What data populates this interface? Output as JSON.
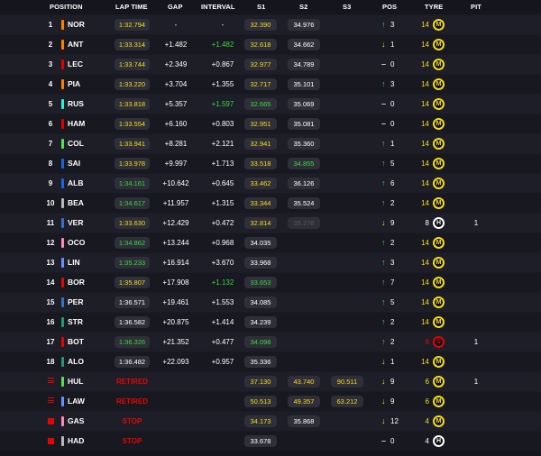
{
  "header": {
    "position": "POSITION",
    "lap_time": "LAP TIME",
    "gap": "GAP",
    "interval": "INTERVAL",
    "s1": "S1",
    "s2": "S2",
    "s3": "S3",
    "pos": "POS",
    "tyre": "TYRE",
    "pit": "PIT"
  },
  "colors": {
    "personal_best": "#3ad83a",
    "normal_time": "#f3de19",
    "retired": "#e10600",
    "medium_tyre": "#f3de19",
    "hard_tyre": "#ffffff",
    "soft_tyre": "#e10600"
  },
  "rows": [
    {
      "pos": "1",
      "status": "normal",
      "team_color": "#ff8000",
      "driver": "NOR",
      "lap": "1:32.794",
      "lap_color": "yellow",
      "gap": "-",
      "interval": "-",
      "interval_color": "white",
      "s1": "32.390",
      "s1_color": "yellow",
      "s2": "34.976",
      "s2_color": "white",
      "s3": "",
      "s3_color": "white",
      "dir": "up",
      "pos_change": "3",
      "tyre_laps": "14",
      "tyre_laps_color": "yellow",
      "tyre": "medium",
      "tyre_letter": "M",
      "pit": ""
    },
    {
      "pos": "2",
      "status": "normal",
      "team_color": "#ff8000",
      "driver": "ANT",
      "lap": "1:33.314",
      "lap_color": "yellow",
      "gap": "+1.482",
      "interval": "+1.482",
      "interval_color": "green",
      "s1": "32.618",
      "s1_color": "yellow",
      "s2": "34.662",
      "s2_color": "white",
      "s3": "",
      "s3_color": "white",
      "dir": "down",
      "pos_change": "1",
      "tyre_laps": "14",
      "tyre_laps_color": "yellow",
      "tyre": "medium",
      "tyre_letter": "M",
      "pit": ""
    },
    {
      "pos": "3",
      "status": "normal",
      "team_color": "#dc0000",
      "driver": "LEC",
      "lap": "1:33.744",
      "lap_color": "yellow",
      "gap": "+2.349",
      "interval": "+0.867",
      "interval_color": "white",
      "s1": "32.977",
      "s1_color": "yellow",
      "s2": "34.789",
      "s2_color": "white",
      "s3": "",
      "s3_color": "white",
      "dir": "same",
      "pos_change": "0",
      "tyre_laps": "14",
      "tyre_laps_color": "yellow",
      "tyre": "medium",
      "tyre_letter": "M",
      "pit": ""
    },
    {
      "pos": "4",
      "status": "normal",
      "team_color": "#ff8000",
      "driver": "PIA",
      "lap": "1:33.220",
      "lap_color": "yellow",
      "gap": "+3.704",
      "interval": "+1.355",
      "interval_color": "white",
      "s1": "32.717",
      "s1_color": "yellow",
      "s2": "35.101",
      "s2_color": "white",
      "s3": "",
      "s3_color": "white",
      "dir": "up",
      "pos_change": "3",
      "tyre_laps": "14",
      "tyre_laps_color": "yellow",
      "tyre": "medium",
      "tyre_letter": "M",
      "pit": ""
    },
    {
      "pos": "5",
      "status": "normal",
      "team_color": "#27f4d2",
      "driver": "RUS",
      "lap": "1:33.818",
      "lap_color": "yellow",
      "gap": "+5.357",
      "interval": "+1.597",
      "interval_color": "green",
      "s1": "32.665",
      "s1_color": "green",
      "s2": "35.069",
      "s2_color": "white",
      "s3": "",
      "s3_color": "white",
      "dir": "same",
      "pos_change": "0",
      "tyre_laps": "14",
      "tyre_laps_color": "yellow",
      "tyre": "medium",
      "tyre_letter": "M",
      "pit": ""
    },
    {
      "pos": "6",
      "status": "normal",
      "team_color": "#dc0000",
      "driver": "HAM",
      "lap": "1:33.554",
      "lap_color": "yellow",
      "gap": "+6.160",
      "interval": "+0.803",
      "interval_color": "white",
      "s1": "32.951",
      "s1_color": "yellow",
      "s2": "35.081",
      "s2_color": "white",
      "s3": "",
      "s3_color": "white",
      "dir": "same",
      "pos_change": "0",
      "tyre_laps": "14",
      "tyre_laps_color": "yellow",
      "tyre": "medium",
      "tyre_letter": "M",
      "pit": ""
    },
    {
      "pos": "7",
      "status": "normal",
      "team_color": "#52e252",
      "driver": "COL",
      "lap": "1:33.941",
      "lap_color": "yellow",
      "gap": "+8.281",
      "interval": "+2.121",
      "interval_color": "white",
      "s1": "32.941",
      "s1_color": "yellow",
      "s2": "35.360",
      "s2_color": "white",
      "s3": "",
      "s3_color": "white",
      "dir": "up",
      "pos_change": "1",
      "tyre_laps": "14",
      "tyre_laps_color": "yellow",
      "tyre": "medium",
      "tyre_letter": "M",
      "pit": ""
    },
    {
      "pos": "8",
      "status": "normal",
      "team_color": "#1868db",
      "driver": "SAI",
      "lap": "1:33.978",
      "lap_color": "yellow",
      "gap": "+9.997",
      "interval": "+1.713",
      "interval_color": "white",
      "s1": "33.518",
      "s1_color": "yellow",
      "s2": "34.855",
      "s2_color": "green",
      "s3": "",
      "s3_color": "white",
      "dir": "up",
      "pos_change": "5",
      "tyre_laps": "14",
      "tyre_laps_color": "yellow",
      "tyre": "medium",
      "tyre_letter": "M",
      "pit": ""
    },
    {
      "pos": "9",
      "status": "normal",
      "team_color": "#1868db",
      "driver": "ALB",
      "lap": "1:34.161",
      "lap_color": "green",
      "gap": "+10.642",
      "interval": "+0.645",
      "interval_color": "white",
      "s1": "33.462",
      "s1_color": "yellow",
      "s2": "36.126",
      "s2_color": "white",
      "s3": "",
      "s3_color": "white",
      "dir": "up",
      "pos_change": "6",
      "tyre_laps": "14",
      "tyre_laps_color": "yellow",
      "tyre": "medium",
      "tyre_letter": "M",
      "pit": ""
    },
    {
      "pos": "10",
      "status": "normal",
      "team_color": "#b6babd",
      "driver": "BEA",
      "lap": "1:34.617",
      "lap_color": "green",
      "gap": "+11.957",
      "interval": "+1.315",
      "interval_color": "white",
      "s1": "33.344",
      "s1_color": "yellow",
      "s2": "35.524",
      "s2_color": "white",
      "s3": "",
      "s3_color": "white",
      "dir": "up",
      "pos_change": "2",
      "tyre_laps": "14",
      "tyre_laps_color": "yellow",
      "tyre": "medium",
      "tyre_letter": "M",
      "pit": ""
    },
    {
      "pos": "11",
      "status": "normal",
      "team_color": "#3671c6",
      "driver": "VER",
      "lap": "1:33.630",
      "lap_color": "yellow",
      "gap": "+12.429",
      "interval": "+0.472",
      "interval_color": "white",
      "s1": "32.814",
      "s1_color": "yellow",
      "s2": "35.278",
      "s2_color": "faded",
      "s3": "",
      "s3_color": "white",
      "dir": "down",
      "pos_change": "9",
      "tyre_laps": "8",
      "tyre_laps_color": "white",
      "tyre": "hard",
      "tyre_letter": "H",
      "pit": "1"
    },
    {
      "pos": "12",
      "status": "normal",
      "team_color": "#ff87bc",
      "driver": "OCO",
      "lap": "1:34.862",
      "lap_color": "green",
      "gap": "+13.244",
      "interval": "+0.968",
      "interval_color": "white",
      "s1": "34.035",
      "s1_color": "white",
      "s2": "",
      "s2_color": "white",
      "s3": "",
      "s3_color": "white",
      "dir": "up",
      "pos_change": "2",
      "tyre_laps": "14",
      "tyre_laps_color": "yellow",
      "tyre": "medium",
      "tyre_letter": "M",
      "pit": ""
    },
    {
      "pos": "13",
      "status": "normal",
      "team_color": "#6692ff",
      "driver": "LIN",
      "lap": "1:35.233",
      "lap_color": "green",
      "gap": "+16.914",
      "interval": "+3.670",
      "interval_color": "white",
      "s1": "33.968",
      "s1_color": "white",
      "s2": "",
      "s2_color": "white",
      "s3": "",
      "s3_color": "white",
      "dir": "up",
      "pos_change": "3",
      "tyre_laps": "14",
      "tyre_laps_color": "yellow",
      "tyre": "medium",
      "tyre_letter": "M",
      "pit": ""
    },
    {
      "pos": "14",
      "status": "normal",
      "team_color": "#e10600",
      "driver": "BOR",
      "lap": "1:35.807",
      "lap_color": "yellow",
      "gap": "+17.908",
      "interval": "+1.132",
      "interval_color": "green",
      "s1": "33.653",
      "s1_color": "green",
      "s2": "",
      "s2_color": "white",
      "s3": "",
      "s3_color": "white",
      "dir": "up",
      "pos_change": "7",
      "tyre_laps": "14",
      "tyre_laps_color": "yellow",
      "tyre": "medium",
      "tyre_letter": "M",
      "pit": ""
    },
    {
      "pos": "15",
      "status": "normal",
      "team_color": "#3671c6",
      "driver": "PER",
      "lap": "1:36.571",
      "lap_color": "white",
      "gap": "+19.461",
      "interval": "+1.553",
      "interval_color": "white",
      "s1": "34.085",
      "s1_color": "white",
      "s2": "",
      "s2_color": "white",
      "s3": "",
      "s3_color": "white",
      "dir": "up",
      "pos_change": "5",
      "tyre_laps": "14",
      "tyre_laps_color": "yellow",
      "tyre": "medium",
      "tyre_letter": "M",
      "pit": ""
    },
    {
      "pos": "16",
      "status": "normal",
      "team_color": "#229971",
      "driver": "STR",
      "lap": "1:36.582",
      "lap_color": "white",
      "gap": "+20.875",
      "interval": "+1.414",
      "interval_color": "white",
      "s1": "34.239",
      "s1_color": "white",
      "s2": "",
      "s2_color": "white",
      "s3": "",
      "s3_color": "white",
      "dir": "up",
      "pos_change": "2",
      "tyre_laps": "14",
      "tyre_laps_color": "yellow",
      "tyre": "medium",
      "tyre_letter": "M",
      "pit": ""
    },
    {
      "pos": "17",
      "status": "normal",
      "team_color": "#e10600",
      "driver": "BOT",
      "lap": "1:36.326",
      "lap_color": "green",
      "gap": "+21.352",
      "interval": "+0.477",
      "interval_color": "white",
      "s1": "34.098",
      "s1_color": "green",
      "s2": "",
      "s2_color": "white",
      "s3": "",
      "s3_color": "white",
      "dir": "up",
      "pos_change": "2",
      "tyre_laps": "8",
      "tyre_laps_color": "red",
      "tyre": "soft",
      "tyre_letter": "S",
      "pit": "1"
    },
    {
      "pos": "18",
      "status": "normal",
      "team_color": "#229971",
      "driver": "ALO",
      "lap": "1:36.482",
      "lap_color": "white",
      "gap": "+22.093",
      "interval": "+0.957",
      "interval_color": "white",
      "s1": "35.336",
      "s1_color": "white",
      "s2": "",
      "s2_color": "white",
      "s3": "",
      "s3_color": "white",
      "dir": "down",
      "pos_change": "1",
      "tyre_laps": "14",
      "tyre_laps_color": "yellow",
      "tyre": "medium",
      "tyre_letter": "M",
      "pit": ""
    },
    {
      "pos": "",
      "status": "retired",
      "status_text": "RETIRED",
      "team_color": "#52e252",
      "driver": "HUL",
      "lap": "",
      "lap_color": "white",
      "gap": "",
      "interval": "",
      "interval_color": "white",
      "s1": "37.130",
      "s1_color": "yellow",
      "s2": "43.740",
      "s2_color": "yellow",
      "s3": "90.511",
      "s3_color": "yellow",
      "dir": "down",
      "pos_change": "9",
      "tyre_laps": "6",
      "tyre_laps_color": "yellow",
      "tyre": "medium",
      "tyre_letter": "M",
      "pit": "1"
    },
    {
      "pos": "",
      "status": "retired",
      "status_text": "RETIRED",
      "team_color": "#6692ff",
      "driver": "LAW",
      "lap": "",
      "lap_color": "white",
      "gap": "",
      "interval": "",
      "interval_color": "white",
      "s1": "50.513",
      "s1_color": "yellow",
      "s2": "49.357",
      "s2_color": "yellow",
      "s3": "63.212",
      "s3_color": "yellow",
      "dir": "down",
      "pos_change": "9",
      "tyre_laps": "6",
      "tyre_laps_color": "yellow",
      "tyre": "medium",
      "tyre_letter": "M",
      "pit": ""
    },
    {
      "pos": "",
      "status": "stop",
      "status_text": "STOP",
      "team_color": "#ff87bc",
      "driver": "GAS",
      "lap": "",
      "lap_color": "white",
      "gap": "",
      "interval": "",
      "interval_color": "white",
      "s1": "34.173",
      "s1_color": "yellow",
      "s2": "35.868",
      "s2_color": "white",
      "s3": "",
      "s3_color": "white",
      "dir": "down",
      "pos_change": "12",
      "tyre_laps": "4",
      "tyre_laps_color": "yellow",
      "tyre": "medium",
      "tyre_letter": "M",
      "pit": ""
    },
    {
      "pos": "",
      "status": "stop",
      "status_text": "STOP",
      "team_color": "#b6babd",
      "driver": "HAD",
      "lap": "",
      "lap_color": "white",
      "gap": "",
      "interval": "",
      "interval_color": "white",
      "s1": "33.678",
      "s1_color": "white",
      "s2": "",
      "s2_color": "white",
      "s3": "",
      "s3_color": "white",
      "dir": "same",
      "pos_change": "0",
      "tyre_laps": "4",
      "tyre_laps_color": "white",
      "tyre": "hard",
      "tyre_letter": "H",
      "pit": ""
    }
  ]
}
